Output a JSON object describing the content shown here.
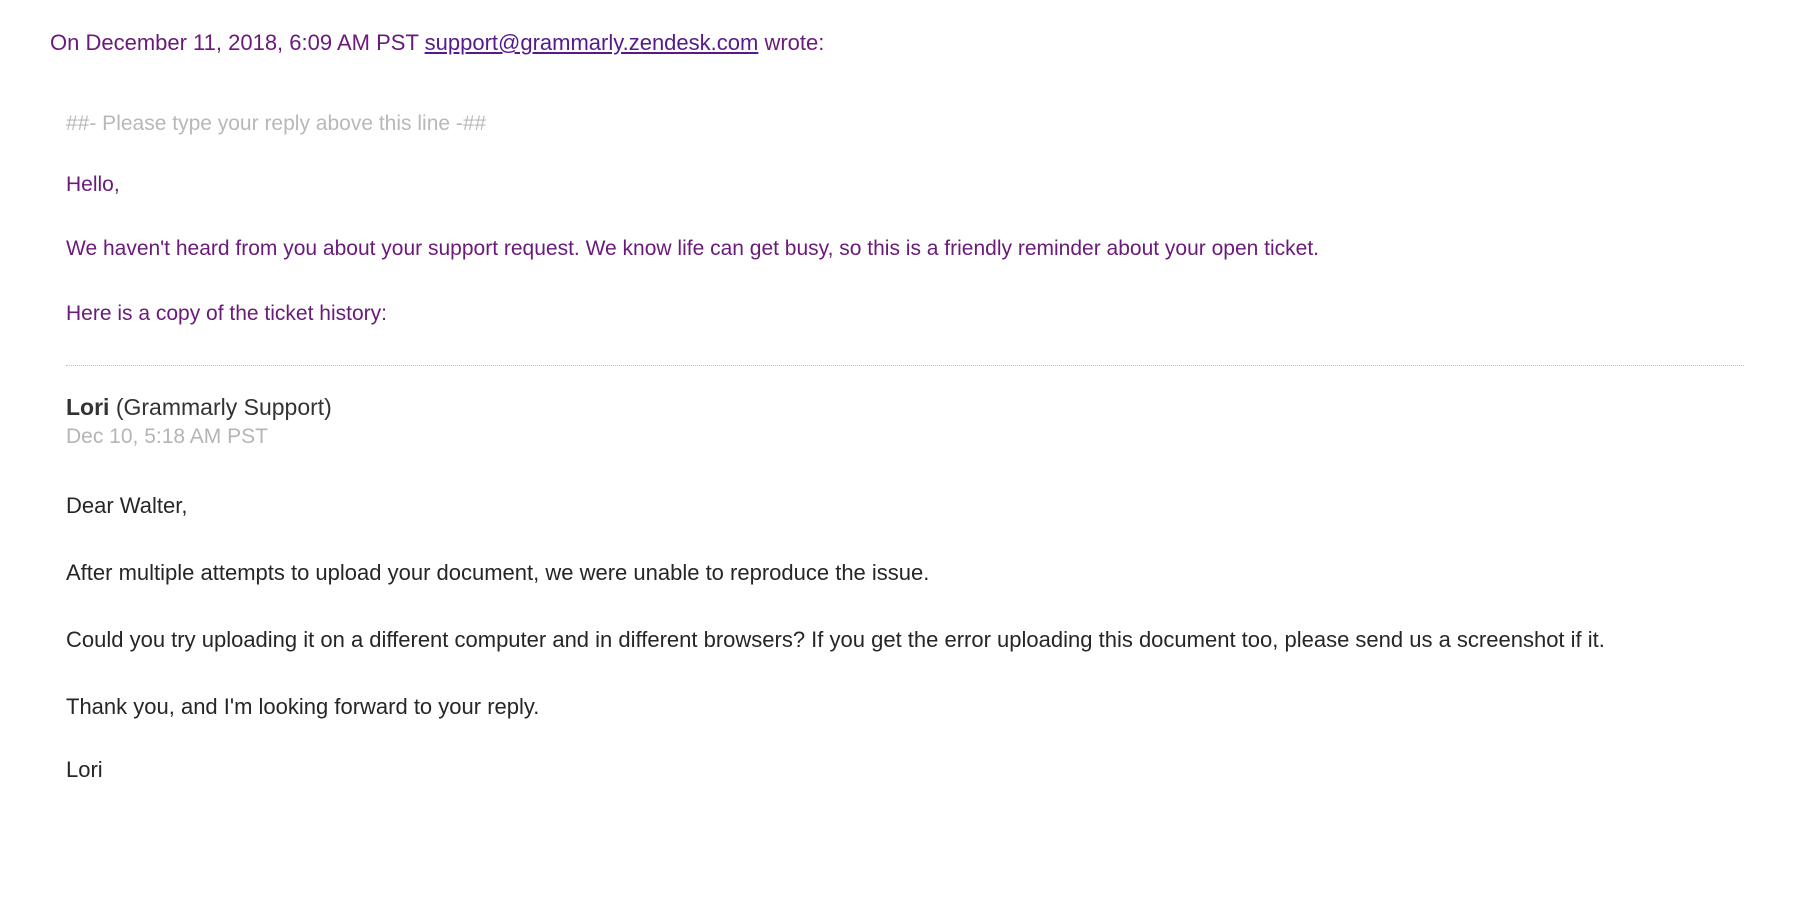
{
  "quote": {
    "prefix": "On December 11, 2018, 6:09 AM PST ",
    "email": "support@grammarly.zendesk.com",
    "suffix": " wrote:"
  },
  "reply_marker": "##- Please type your reply above this line -##",
  "intro": {
    "greeting": "Hello,",
    "line1": "We haven't heard from you about your support request. We know life can get busy, so this is a friendly reminder about your open ticket.",
    "line2": "Here is a copy of the ticket history:"
  },
  "agent": {
    "name": "Lori",
    "org": " (Grammarly Support)",
    "timestamp": "Dec 10, 5:18 AM PST"
  },
  "body": {
    "salutation": "Dear Walter,",
    "p1": "After multiple attempts to upload your document, we were unable to reproduce the issue.",
    "p2": "Could you try uploading it on a different computer and in different browsers? If you get the error uploading this document too, please send us a screenshot if it.",
    "p3": "Thank you, and I'm looking forward to your reply.",
    "signature": "Lori"
  }
}
